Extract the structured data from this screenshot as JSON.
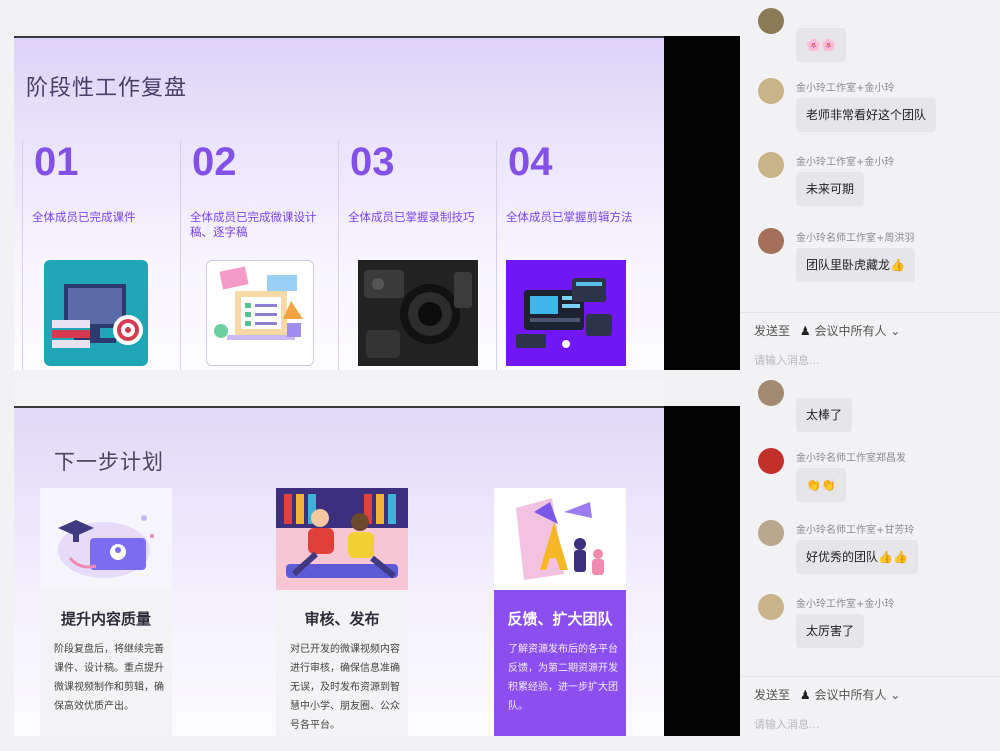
{
  "slide1": {
    "title": "阶段性工作复盘",
    "items": [
      {
        "num": "01",
        "desc": "全体成员已完成课件"
      },
      {
        "num": "02",
        "desc": "全体成员已完成微课设计稿、逐字稿"
      },
      {
        "num": "03",
        "desc": "全体成员已掌握录制技巧"
      },
      {
        "num": "04",
        "desc": "全体成员已掌握剪辑方法"
      }
    ]
  },
  "slide2": {
    "title": "下一步计划",
    "cards": [
      {
        "title": "提升内容质量",
        "body": "阶段复盘后，将继续完善课件、设计稿。重点提升微课视频制作和剪辑，确保高效优质产出。"
      },
      {
        "title": "审核、发布",
        "body": "对已开发的微课视频内容进行审核，确保信息准确无误，及时发布资源到智慧中小学、朋友圈、公众号各平台。"
      },
      {
        "title": "反馈、扩大团队",
        "body": "了解资源发布后的各平台反馈，为第二期资源开发积累经验，进一步扩大团队。"
      }
    ]
  },
  "chat": {
    "messages_top": [
      {
        "sender": "",
        "text": "🌸🌸"
      },
      {
        "sender": "金小玲工作室+金小玲",
        "text": "老师非常看好这个团队"
      },
      {
        "sender": "金小玲工作室+金小玲",
        "text": "未来可期"
      },
      {
        "sender": "金小玲名师工作室+周洪羽",
        "text": "团队里卧虎藏龙👍"
      }
    ],
    "send_label": "发送至",
    "send_target": "会议中所有人",
    "input_placeholder": "请输入消息...",
    "messages_bottom": [
      {
        "sender": "",
        "text": "太棒了"
      },
      {
        "sender": "金小玲名师工作室郑昌发",
        "text": "👏👏"
      },
      {
        "sender": "金小玲名师工作室+甘芳玲",
        "text": "好优秀的团队👍👍"
      },
      {
        "sender": "金小玲工作室+金小玲",
        "text": "太厉害了"
      }
    ]
  },
  "colors": {
    "accent": "#8451e8",
    "card_purple": "#8b4ff0",
    "black_panel": "#030303"
  }
}
